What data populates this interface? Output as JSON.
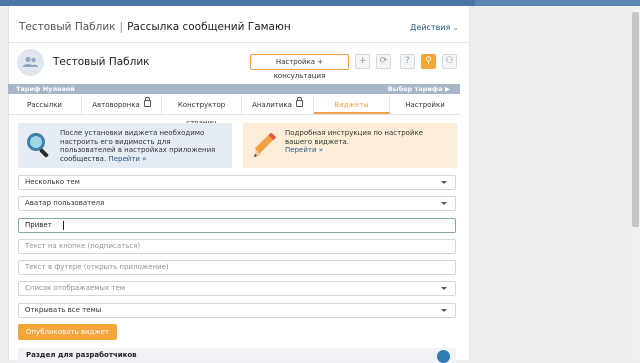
{
  "breadcrumbs": {
    "group": "Тестовый Паблик",
    "separator": "|",
    "current": "Рассылка сообщений Гамаюн"
  },
  "actions_label": "Действия",
  "group_name": "Тестовый Паблик",
  "plan_button": "Настройка + консультация",
  "toolbar_icons": [
    "plus-icon",
    "refresh-icon",
    "help-icon",
    "gift-icon",
    "user-icon"
  ],
  "tariff": {
    "label": "Тариф Нулевой",
    "choose": "Выбор тарифа ▶"
  },
  "tabs": [
    {
      "label": "Рассылки",
      "locked": false
    },
    {
      "label": "Автоворонка",
      "locked": true
    },
    {
      "label": "Конструктор страниц",
      "locked": false
    },
    {
      "label": "Аналитика",
      "locked": true
    },
    {
      "label": "Виджеты",
      "locked": false,
      "active": true
    },
    {
      "label": "Настройки",
      "locked": false
    }
  ],
  "info_blue": {
    "text": "После установки виджета необходимо настроить его видимость для пользователей в настройках приложения сообщества.",
    "link": "Перейти »"
  },
  "info_peach": {
    "text": "Подробная инструкция по настройке вашего виджета.",
    "link": "Перейти »"
  },
  "fields": {
    "topics_select": "Несколько тем",
    "avatar_select": "Аватар пользователя",
    "greeting_value": "Привет",
    "button_text_placeholder": "Текст на кнопке (подписаться)",
    "footer_text_placeholder": "Текст в футере (открыть приложение)",
    "topics_list_placeholder": "Список отображаемых тем",
    "open_select": "Открывать все темы"
  },
  "publish_button": "Опубликовать виджет",
  "dev_section": "Раздел для разработчиков",
  "colors": {
    "accent": "#f3a43b",
    "link": "#2a5885",
    "header": "#4a76a8"
  }
}
